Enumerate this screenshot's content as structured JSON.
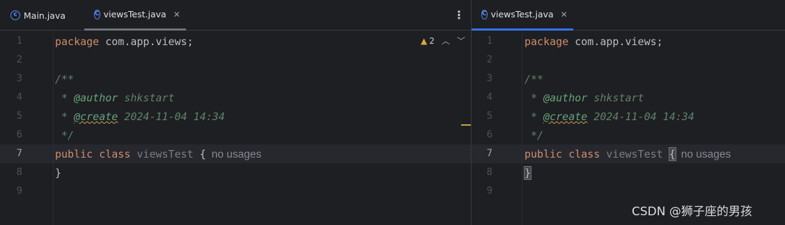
{
  "left": {
    "tabs": [
      {
        "label": "Main.java",
        "icon": "java-class-icon",
        "closable": false
      },
      {
        "label": "viewsTest.java",
        "icon": "class-icon",
        "closable": true
      }
    ],
    "more_icon": "⋮",
    "inspection": {
      "warnings": "2"
    }
  },
  "right": {
    "tabs": [
      {
        "label": "viewsTest.java",
        "icon": "class-icon",
        "closable": true
      }
    ]
  },
  "code": {
    "line_numbers": [
      "1",
      "2",
      "3",
      "4",
      "5",
      "6",
      "7",
      "8",
      "9"
    ],
    "package_kw": "package",
    "package_name": " com.app.views;",
    "doc_open": "/**",
    "author_prefix": " * ",
    "author_tag": "@author",
    "author_val": " shkstart",
    "create_prefix": " * ",
    "create_tag": "@create",
    "create_val": " 2024-11-04 14:34",
    "doc_close": " */",
    "public_kw": "public",
    "class_kw": "class",
    "class_name": "viewsTest",
    "open_brace": "{",
    "usages_hint": "no usages",
    "close_brace": "}"
  },
  "watermark": "CSDN @狮子座的男孩",
  "colors": {
    "accent": "#3574f0",
    "keyword": "#cf8e6d",
    "doc_comment": "#5f826b"
  }
}
